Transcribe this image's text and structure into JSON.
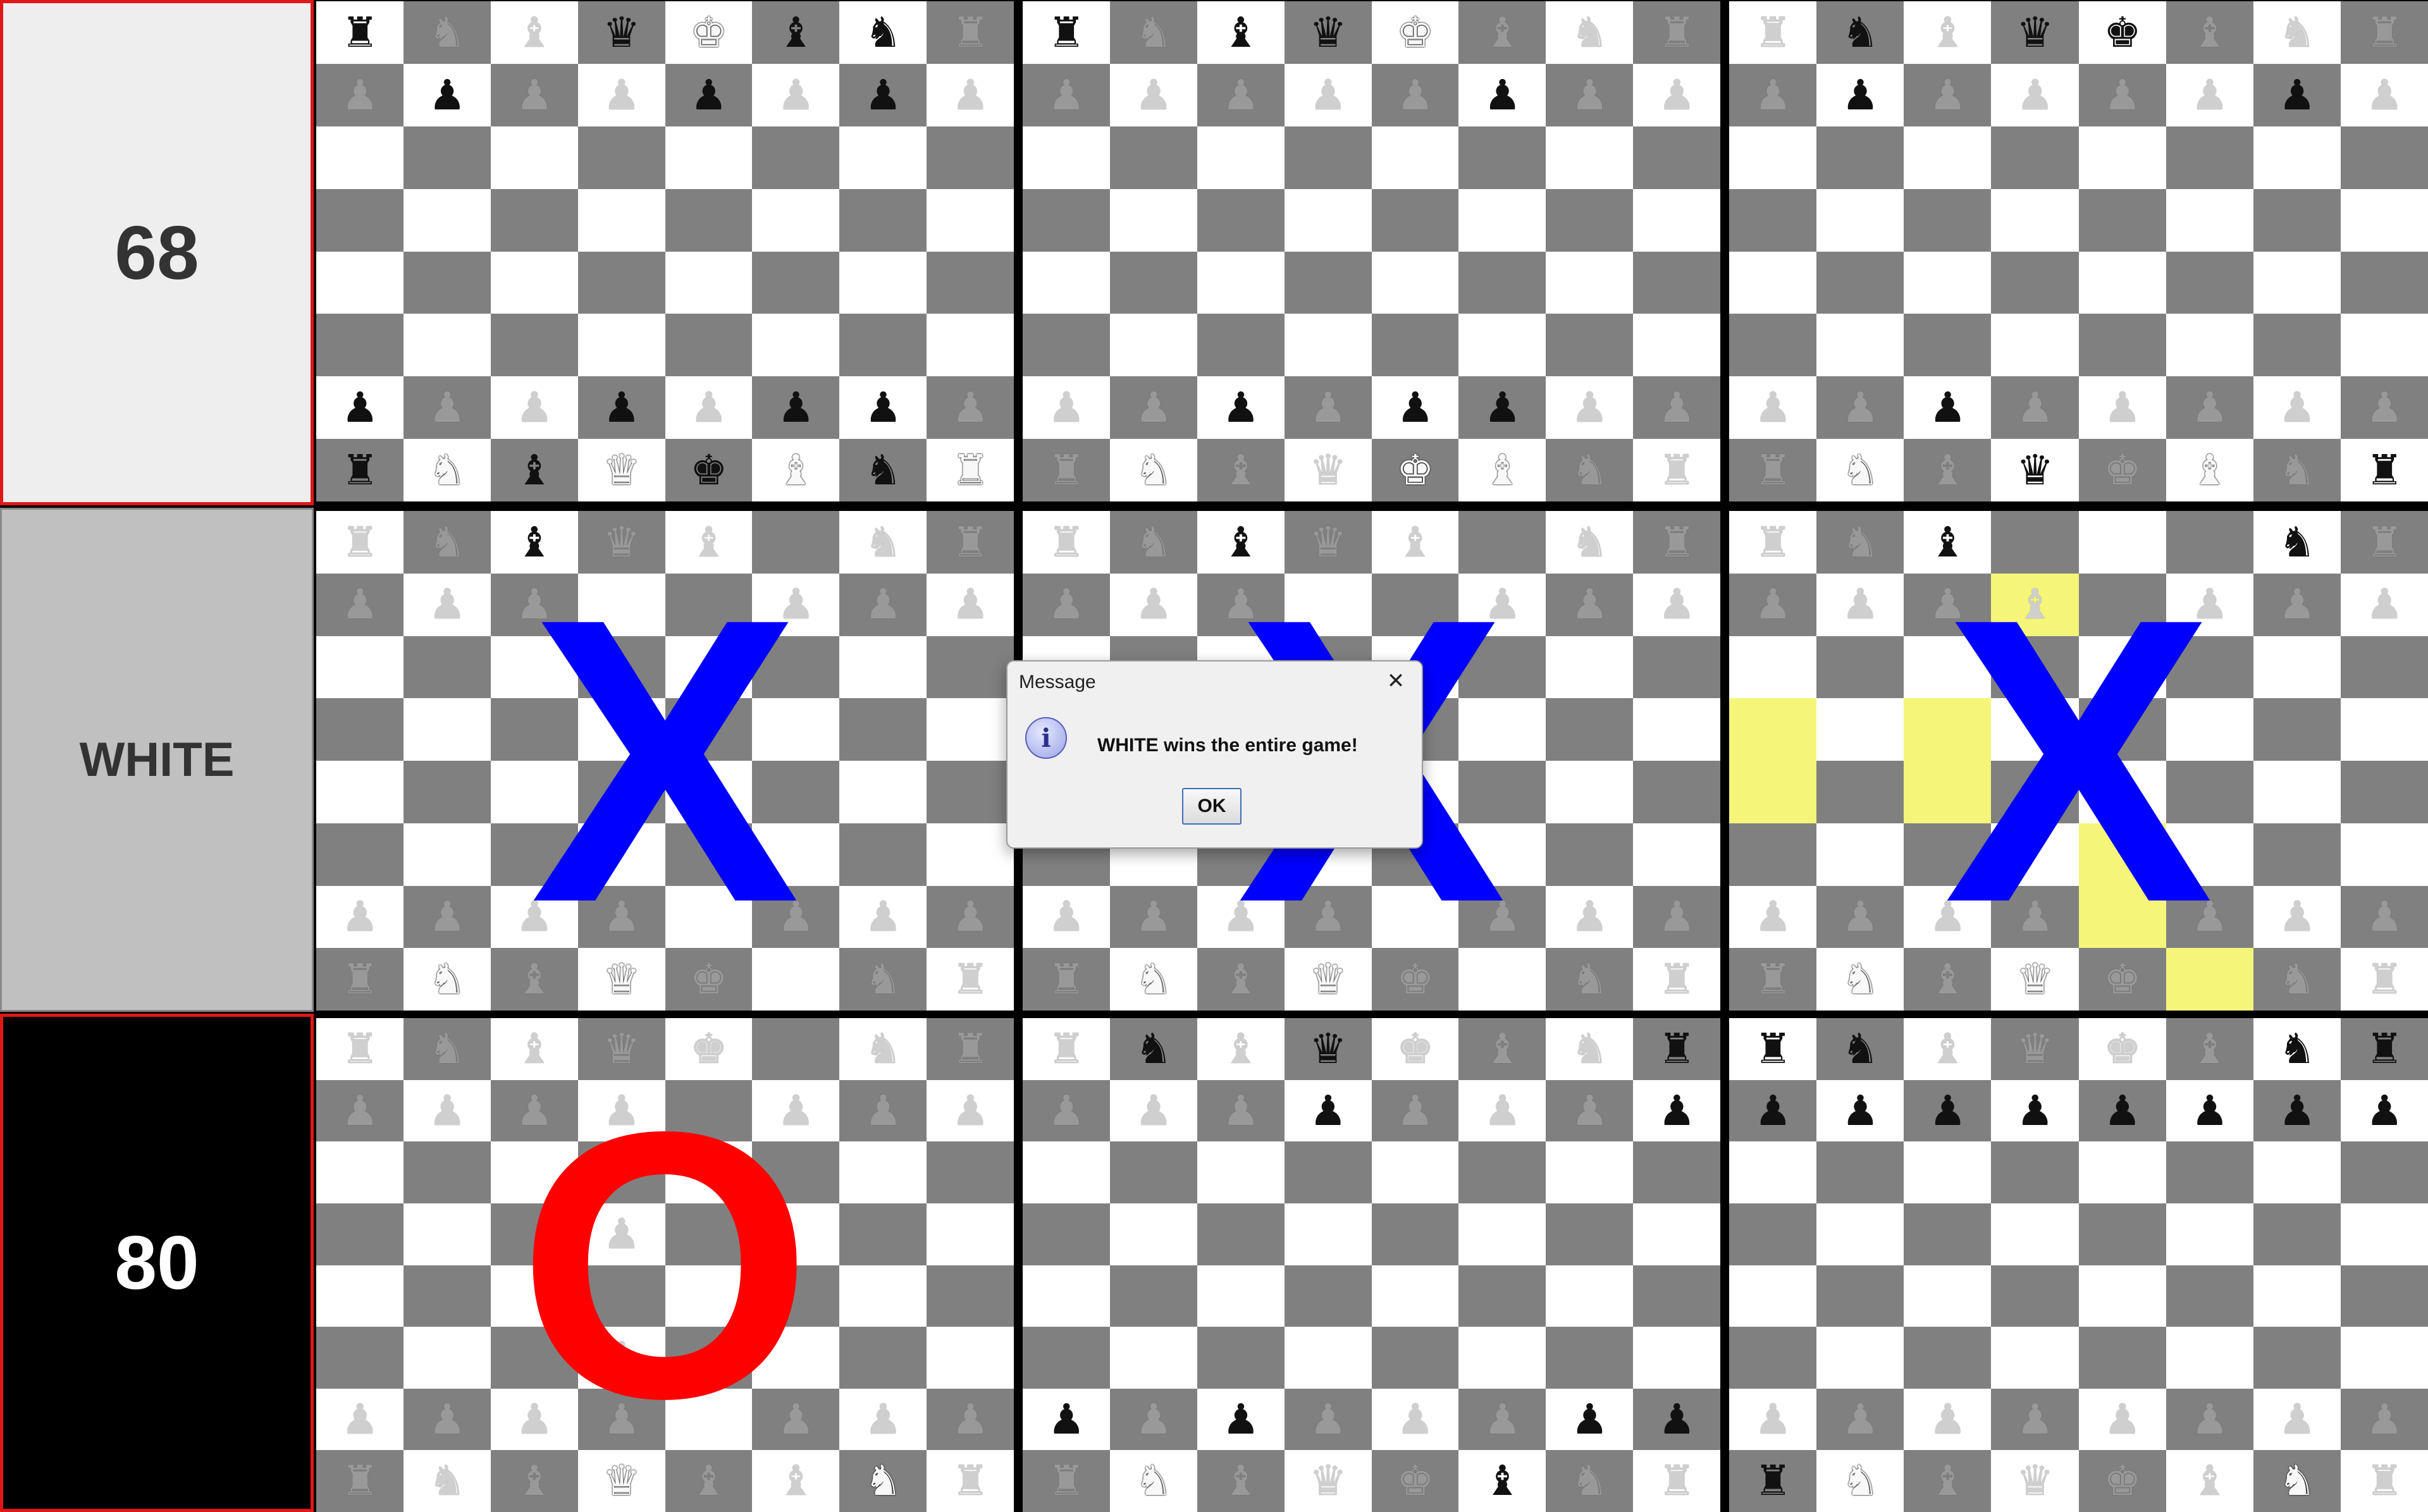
{
  "sidebar": {
    "top_value": "68",
    "turn_label": "WHITE",
    "bottom_value": "80"
  },
  "colors": {
    "dark_square": "#808080",
    "light_square": "#ffffff",
    "highlight": "#f5f57a",
    "x_mark": "#0000ff",
    "o_mark": "#ff0000",
    "frame": "#e01818"
  },
  "boards": [
    {
      "mark": "",
      "rows": [
        "RNBQKBNR",
        "pPpppPPp",
        "........",
        "........",
        "........",
        "........",
        "PpPPpPPp",
        "RNBQKBNR"
      ],
      "shade": [
        "bggbwbbg",
        "gbggbgbg",
        "........",
        "........",
        "........",
        "........",
        "bggbgbbg",
        "bwbwbwbw"
      ]
    },
    {
      "mark": "",
      "rows": [
        "RNBQKBNR",
        "pPpppPPp",
        "........",
        "........",
        "........",
        "........",
        "PpPPpPPp",
        "RNBQKBNR"
      ],
      "shade": [
        "bgbbwggg",
        "gggggbgg",
        "........",
        "........",
        "........",
        "........",
        "ggbgbbgg",
        "gwggwwgg"
      ]
    },
    {
      "mark": "",
      "rows": [
        "RNBQKBNR",
        "pPpppPPp",
        "........",
        "........",
        "........",
        "........",
        "PpPPpPPp",
        "RNBQKBNR"
      ],
      "shade": [
        "gbgbbggg",
        "gbggggbg",
        "........",
        "........",
        "........",
        "........",
        "ggbggggg",
        "gwgbgwgb"
      ]
    },
    {
      "mark": "X",
      "rows": [
        "RNBQB.NR",
        "pPp..ppp",
        "........",
        "........",
        "........",
        "........",
        "PpPP.pPP",
        "RNBQK.NR"
      ],
      "shade": [
        "ggbggggg",
        "gggggggg",
        "........",
        "........",
        "........",
        "........",
        "gggggggg",
        "gwgwgggg"
      ]
    },
    {
      "mark": "X",
      "rows": [
        "RNBQB.NR",
        "pPp..ppp",
        "........",
        "........",
        "........",
        "........",
        "PpPP.pPP",
        "RNBQK.NR"
      ],
      "shade": [
        "ggbggggg",
        "gggggggg",
        "........",
        "........",
        "........",
        "........",
        "gggggggg",
        "gwgwgggg"
      ]
    },
    {
      "mark": "X",
      "rows": [
        "RNB...NR",
        "pPpB.ppp",
        "........",
        "........",
        "........",
        "........",
        "PpPP.pPP",
        "RNBQK.NR"
      ],
      "shade": [
        "ggbgggbg",
        "gggggggg",
        "........",
        "........",
        "........",
        "........",
        "gggggggg",
        "gwgwgggg"
      ],
      "highlights": [
        "1-3",
        "3-0",
        "3-2",
        "4-0",
        "4-2",
        "5-4",
        "6-4",
        "7-5"
      ]
    },
    {
      "mark": "O",
      "rows": [
        "RNBQK.NR",
        "pPpp.ppp",
        "........",
        "...P....",
        "........",
        "...P....",
        "PpPP.pPP",
        "RNBQBBNR"
      ],
      "shade": [
        "gggggggg",
        "gggggggg",
        "........",
        "...g....",
        "........",
        "...g....",
        "gggggggg",
        "gggwggwg"
      ]
    },
    {
      "mark": "",
      "rows": [
        "RNBQKBNR",
        "pPpppPPp",
        "........",
        "........",
        "........",
        "........",
        "PpPPpPPp",
        "RNBQKBNR"
      ],
      "shade": [
        "gbgbgggb",
        "gggbgggb",
        "........",
        "........",
        "........",
        "........",
        "bgbgggbb",
        "gwgggbgg"
      ]
    },
    {
      "mark": "",
      "rows": [
        "RNBQKBNR",
        "pPpppPPp",
        "........",
        "........",
        "........",
        "........",
        "PpPPpPPp",
        "RNBQKBNR"
      ],
      "shade": [
        "bbggggbb",
        "bbbbbbbb",
        "........",
        "........",
        "........",
        "........",
        "gggggggg",
        "bwggggwg"
      ]
    }
  ],
  "dialog": {
    "title": "Message",
    "close_symbol": "✕",
    "icon_symbol": "i",
    "message": "WHITE wins the entire game!",
    "ok_label": "OK"
  }
}
